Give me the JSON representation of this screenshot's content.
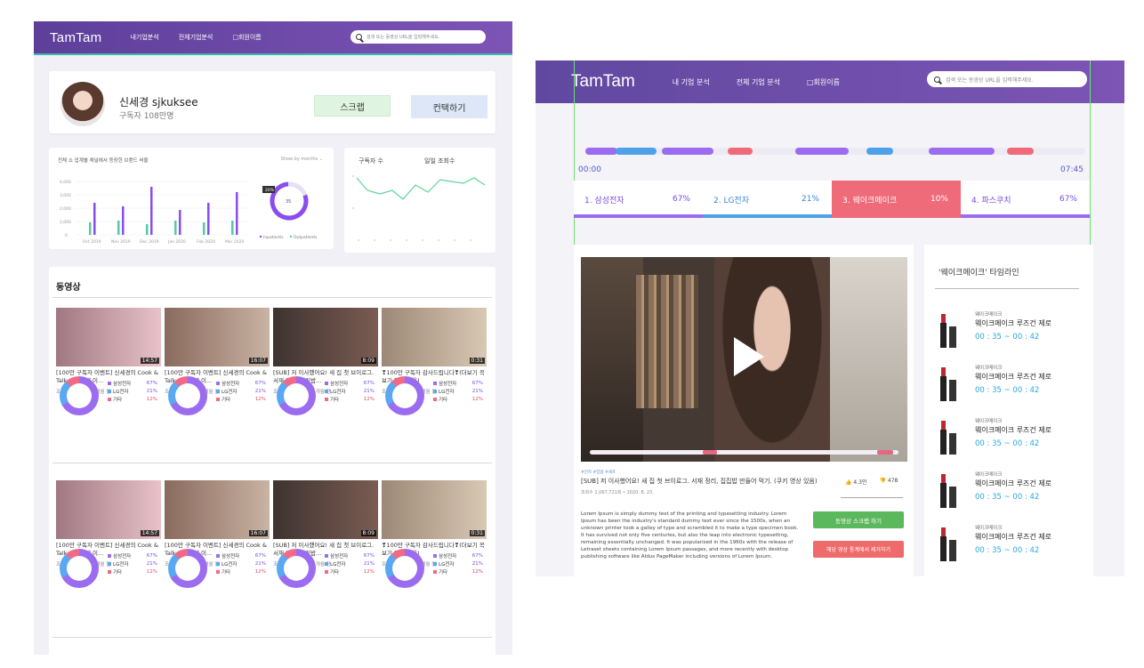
{
  "left": {
    "nav": {
      "logo": "TamTam",
      "menu": [
        "내기업분석",
        "전체기업분석",
        "□회원이름"
      ],
      "search_placeholder": "검색 또는 동영상 URL을 입력해주세요."
    },
    "profile": {
      "name": "신세경 sjkuksee",
      "subscribers": "구독자 108만명",
      "scrap_label": "스크랩",
      "contact_label": "컨택하기"
    },
    "chart1": {
      "title": "전체 쇼 업계별 채널에서 등장한 브랜드 비율",
      "selector": "Show by months",
      "y_ticks": [
        "4,000",
        "3,000",
        "2,000",
        "1,000",
        "0"
      ],
      "x_ticks": [
        "Oct 2019",
        "Nov 2019",
        "Dec 2019",
        "Jan 2020",
        "Feb 2020",
        "Mar 2020"
      ],
      "legend": [
        "Inpatients",
        "Outpatients"
      ],
      "donut_label": "20%",
      "donut_center": "35"
    },
    "chart2": {
      "title_a": "구독자 수",
      "title_b": "일일 조회수"
    },
    "videos_heading": "동영상",
    "videos": [
      {
        "title": "[100만 구독자 이벤트] 신세경의 Cook & Talk - 두 번째 이...",
        "meta": "조회수 26만회 • 1개월 전",
        "duration": "14:57"
      },
      {
        "title": "[100만 구독자 이벤트] 신세경의 Cook & Talk - 첫 번째 이...",
        "meta": "조회수 35만회 • 1개월 전",
        "duration": "16:07"
      },
      {
        "title": "[SUB] 저 이사했어요! 새 집 첫 브이로그. 서재 정리, 집집밥...",
        "meta": "조회수 208만회 • 1개월 전",
        "duration": "8:09"
      },
      {
        "title": "❣100만 구독자 감사드립니다❣(더보기 꼭 보기 안내 있음)",
        "meta": "조회수 49만회 • 2개월 전",
        "duration": "0:31"
      }
    ],
    "pie_legend": [
      {
        "label": "삼성전자",
        "pct": "67%",
        "color": "#9b6cf0"
      },
      {
        "label": "LG전자",
        "pct": "21%",
        "color": "#5aa7f2"
      },
      {
        "label": "기타",
        "pct": "12%",
        "color": "#f06a87"
      }
    ]
  },
  "right": {
    "nav": {
      "logo": "TamTam",
      "menu": [
        "내 기업 분석",
        "전체 기업 분석",
        "□회원이름"
      ],
      "search_placeholder": "검색 또는 동영상 URL을 입력해주세요."
    },
    "time_start": "00:00",
    "time_end": "07:45",
    "brands": [
      {
        "label": "1. 삼성전자",
        "pct": "67%",
        "color": "#9b6cf0"
      },
      {
        "label": "2. LG전자",
        "pct": "21%",
        "color": "#4ea1e8"
      },
      {
        "label": "3. 웨이크메이크",
        "pct": "10%",
        "color": "#ef6b79"
      },
      {
        "label": "4. 파스쿠치",
        "pct": "67%",
        "color": "#9b6cf0"
      }
    ],
    "video": {
      "tag": "#전자 #집밥 #셰프",
      "title": "[SUB] 저 이사했어요! 새 집 첫 브이로그. 서재 정리, 집집밥 만들어 먹기. (쿠키 영상 있음)",
      "meta": "조회수 2,067,721회 • 2020. 8. 23.",
      "likes": "4.3만",
      "dislikes": "478",
      "description": "Lorem Ipsum is simply dummy text of the printing and typesetting industry. Lorem Ipsum has been the industry's standard dummy text ever since the 1500s, when an unknown printer took a galley of type and scrambled it to make a type specimen book. It has survived not only five centuries, but also the leap into electronic typesetting, remaining essentially unchanged. It was popularised in the 1960s with the release of Letraset sheets containing Lorem Ipsum passages, and more recently with desktop publishing software like Aldus PageMaker including versions of Lorem Ipsum.",
      "scrap_button": "동영상 스크랩 하기",
      "remove_button": "해당 영상 통계에서 제거하기"
    },
    "sidebar": {
      "title": "'웨이크메이크' 타임라인",
      "items": [
        {
          "brand": "웨이크메이크",
          "name": "웨이크메이크 루즈건 제로",
          "time": "00 : 35 ~ 00 : 42"
        },
        {
          "brand": "웨이크메이크",
          "name": "웨이크메이크 루즈건 제로",
          "time": "00 : 35 ~ 00 : 42"
        },
        {
          "brand": "웨이크메이크",
          "name": "웨이크메이크 루즈건 제로",
          "time": "00 : 35 ~ 00 : 42"
        },
        {
          "brand": "웨이크메이크",
          "name": "웨이크메이크 루즈건 제로",
          "time": "00 : 35 ~ 00 : 42"
        },
        {
          "brand": "웨이크메이크",
          "name": "웨이크메이크 루즈건 제로",
          "time": "00 : 35 ~ 00 : 42"
        }
      ]
    }
  }
}
